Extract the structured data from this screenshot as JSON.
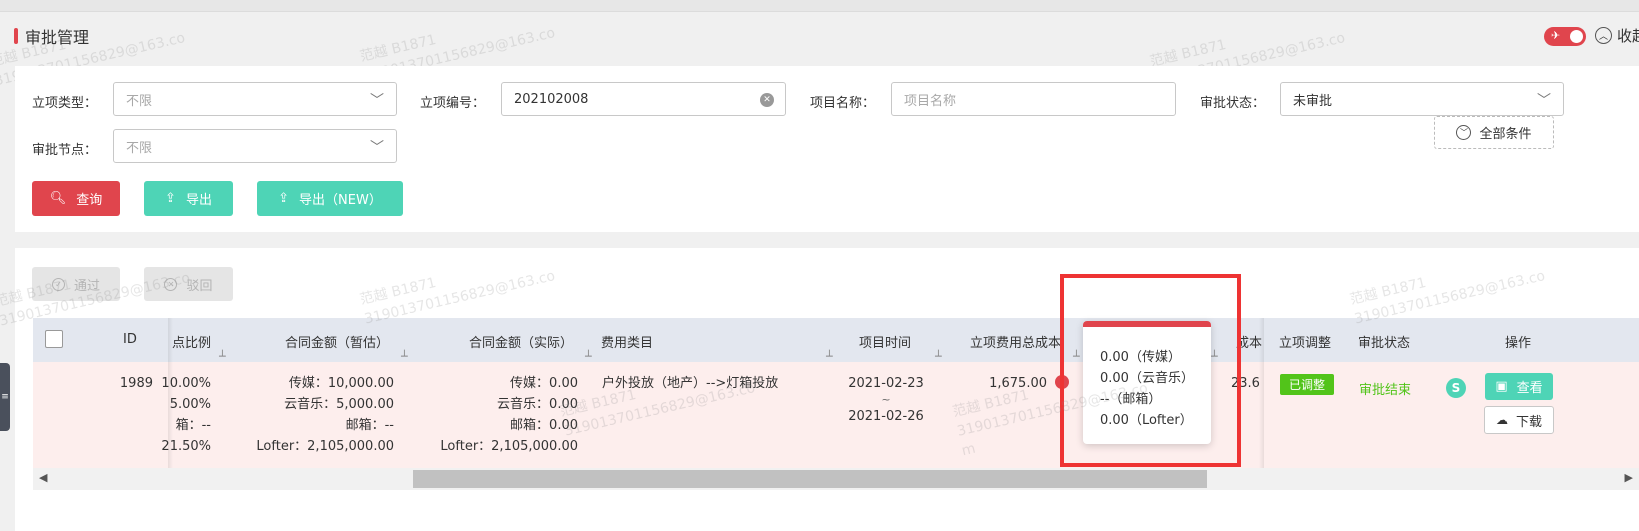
{
  "page": {
    "title": "审批管理"
  },
  "header": {
    "collapse_label": "收起",
    "pin_icon": "pin-icon"
  },
  "filters": {
    "project_type": {
      "label": "立项类型：",
      "placeholder": "不限"
    },
    "project_no": {
      "label": "立项编号：",
      "value": "202102008"
    },
    "project_name": {
      "label": "项目名称：",
      "placeholder": "项目名称"
    },
    "approval_status": {
      "label": "审批状态：",
      "value": "未审批"
    },
    "approval_node": {
      "label": "审批节点：",
      "placeholder": "不限"
    }
  },
  "actions": {
    "query": "查询",
    "export": "导出",
    "export_new": "导出（NEW）",
    "all_conditions": "全部条件",
    "approve": "通过",
    "reject": "驳回"
  },
  "table": {
    "columns": {
      "id": "ID",
      "ratio": "点比例",
      "contract_est": "合同金额（暂估）",
      "contract_actual": "合同金额（实际）",
      "expense_category": "费用类目",
      "project_time": "项目时间",
      "total_cost": "立项费用总成本",
      "cost": "成本",
      "adjust": "立项调整",
      "status": "审批状态",
      "operation": "操作"
    },
    "row": {
      "id": "1989",
      "ratio": [
        "10.00%",
        "5.00%",
        "箱：--",
        "21.50%"
      ],
      "contract_est": [
        "传媒：10,000.00",
        "云音乐：5,000.00",
        "邮箱：--",
        "Lofter：2,105,000.00"
      ],
      "contract_actual": [
        "传媒：0.00",
        "云音乐：0.00",
        "邮箱：0.00",
        "Lofter：2,105,000.00"
      ],
      "expense_category": "户外投放（地产）-->灯箱投放",
      "time_start": "2021-02-23",
      "time_sep": "~",
      "time_end": "2021-02-26",
      "total_cost": "1,675.00",
      "cost_partial": "23.6",
      "adjust_badge": "已调整",
      "status": "审批结束",
      "s_badge": "S",
      "view": "查看",
      "download": "下载"
    }
  },
  "popover": {
    "lines": [
      "0.00（传媒）",
      "0.00（云音乐）",
      "--（邮箱）",
      "0.00（Lofter）"
    ]
  },
  "watermark": {
    "name": "范越 B1871",
    "email": "319013701156829@163.co",
    "tail": "m"
  },
  "colors": {
    "accent_red": "#e0454d",
    "teal": "#4ed4b6",
    "green": "#52c41a",
    "highlight": "#ee3333"
  }
}
